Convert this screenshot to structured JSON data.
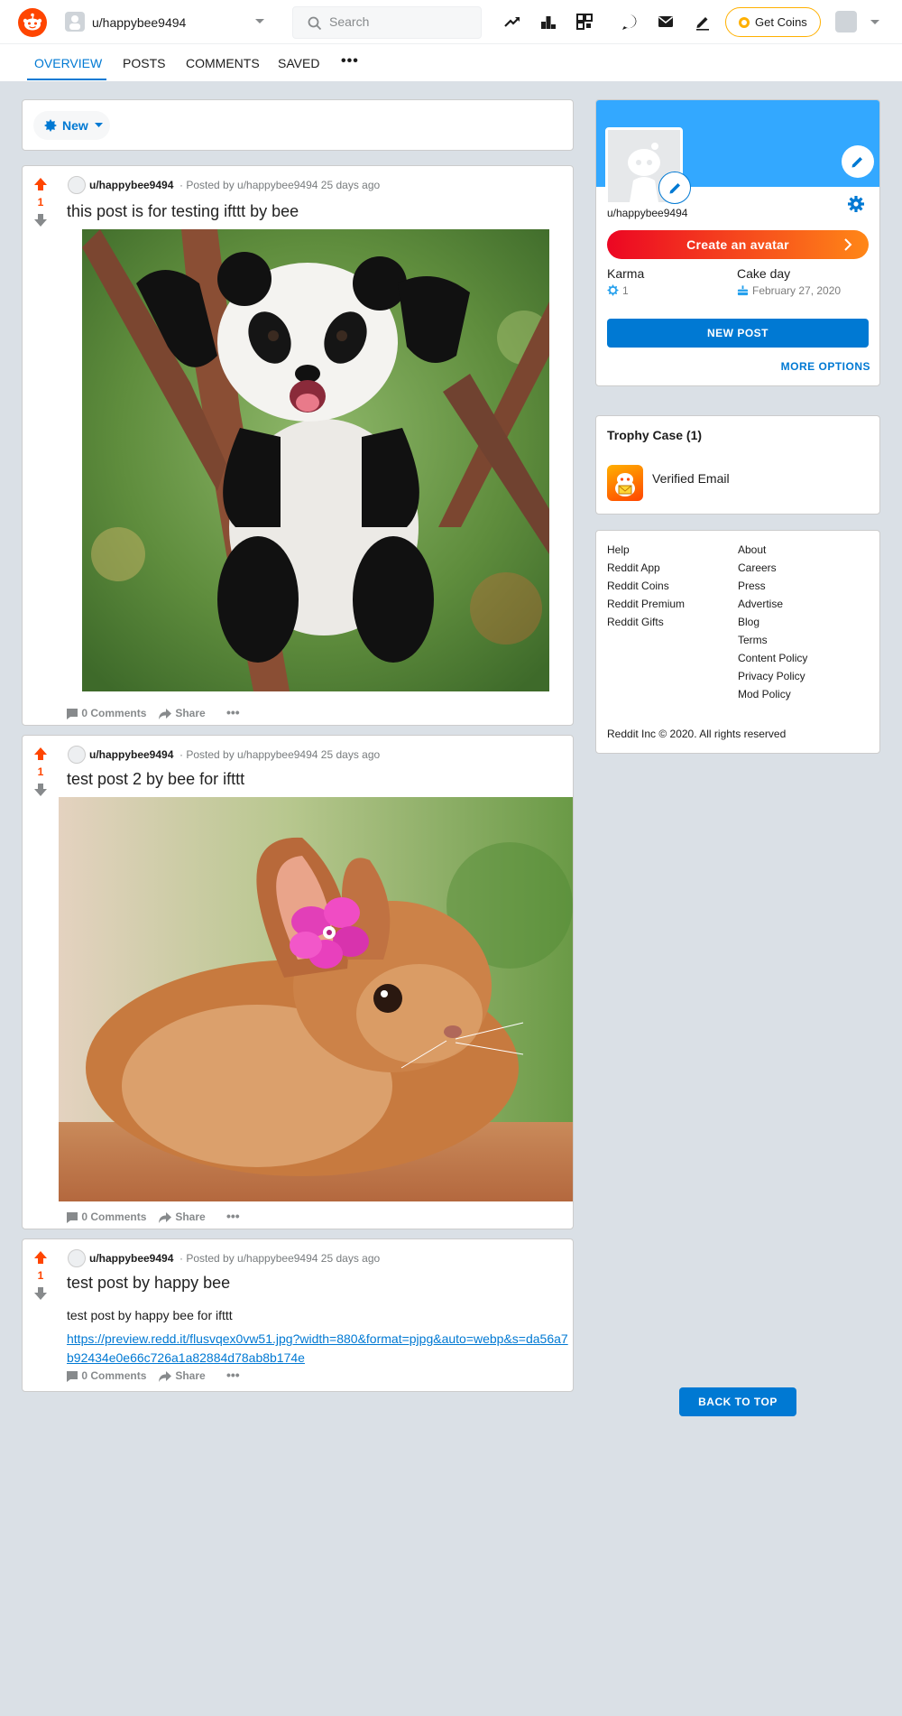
{
  "header": {
    "username": "u/happybee9494",
    "search_placeholder": "Search",
    "get_coins_label": "Get Coins"
  },
  "tabs": {
    "overview": "OVERVIEW",
    "posts": "POSTS",
    "comments": "COMMENTS",
    "saved": "SAVED",
    "more": "•••"
  },
  "sort": {
    "label": "New"
  },
  "posts": [
    {
      "score": "1",
      "author": "u/happybee9494",
      "posted": "· Posted by u/happybee9494 25 days ago",
      "title": "this post is for testing ifttt by bee",
      "comments_label": "0 Comments",
      "share_label": "Share"
    },
    {
      "score": "1",
      "author": "u/happybee9494",
      "posted": "· Posted by u/happybee9494 25 days ago",
      "title": "test post 2 by bee for ifttt",
      "comments_label": "0 Comments",
      "share_label": "Share"
    },
    {
      "score": "1",
      "author": "u/happybee9494",
      "posted": "· Posted by u/happybee9494 25 days ago",
      "title": "test post by happy bee",
      "body": "test post by happy bee for ifttt",
      "link": "https://preview.redd.it/flusvqex0vw51.jpg?width=880&format=pjpg&auto=webp&s=da56a7b92434e0e66c726a1a82884d78ab8b174e",
      "comments_label": "0 Comments",
      "share_label": "Share"
    }
  ],
  "profile": {
    "name": "u/happybee9494",
    "create_avatar_label": "Create an avatar",
    "karma_label": "Karma",
    "karma_value": "1",
    "cakeday_label": "Cake day",
    "cakeday_value": "February 27, 2020",
    "new_post_label": "NEW POST",
    "more_options_label": "MORE OPTIONS"
  },
  "trophy": {
    "title": "Trophy Case (1)",
    "items": [
      {
        "name": "Verified Email"
      }
    ]
  },
  "footer": {
    "left_links": [
      "Help",
      "Reddit App",
      "Reddit Coins",
      "Reddit Premium",
      "Reddit Gifts"
    ],
    "right_links": [
      "About",
      "Careers",
      "Press",
      "Advertise",
      "Blog",
      "Terms",
      "Content Policy",
      "Privacy Policy",
      "Mod Policy"
    ],
    "copyright": "Reddit Inc © 2020. All rights reserved"
  },
  "back_to_top_label": "BACK TO TOP",
  "colors": {
    "accent": "#0079d3",
    "brand": "#ff4500",
    "page_bg": "#dae0e6"
  }
}
